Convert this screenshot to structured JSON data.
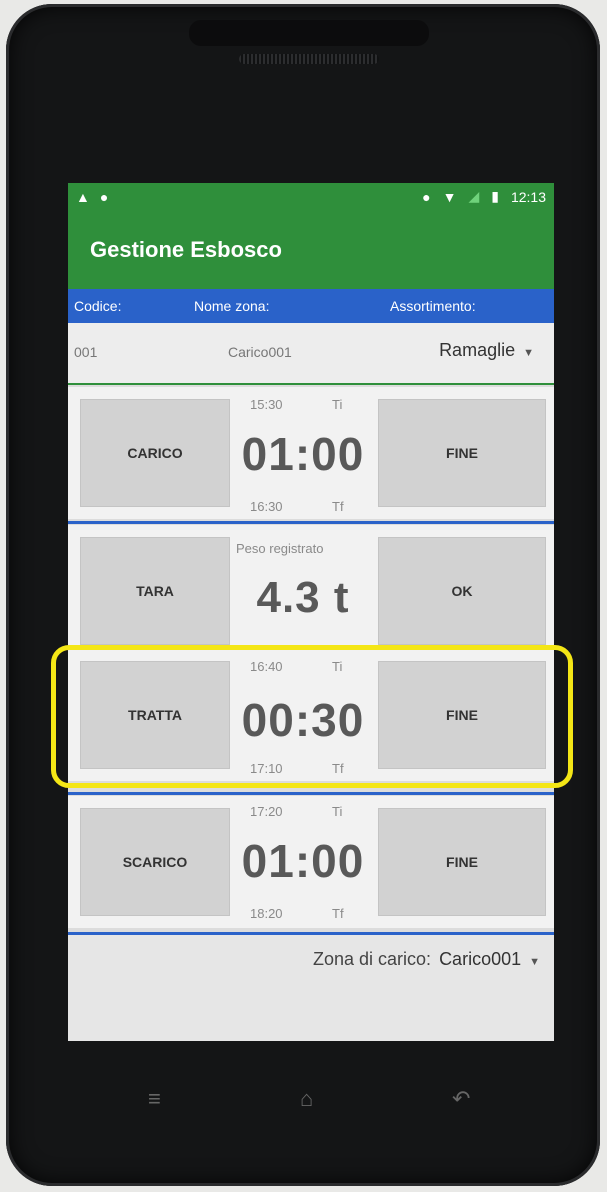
{
  "status_bar": {
    "time": "12:13",
    "left_icons": [
      "warning-icon",
      "dot-icon"
    ],
    "right_icons": [
      "location-icon",
      "wifi-icon",
      "signal-icon",
      "battery-icon"
    ]
  },
  "app": {
    "title": "Gestione Esbosco",
    "primary_color": "#2f8f3b",
    "accent_color": "#2a62c9"
  },
  "header": {
    "col_code": "Codice:",
    "col_zone": "Nome zona:",
    "col_assortment": "Assortimento:"
  },
  "info_row": {
    "code": "001",
    "zone_name": "Carico001",
    "assortment": "Ramaglie"
  },
  "sections": {
    "carico": {
      "label": "CARICO",
      "ti": "15:30",
      "ti_label": "Ti",
      "duration": "01:00",
      "tf": "16:30",
      "tf_label": "Tf",
      "end_label": "FINE"
    },
    "tara": {
      "label": "TARA",
      "caption": "Peso registrato",
      "weight": "4.3 t",
      "ok_label": "OK"
    },
    "tratta": {
      "label": "TRATTA",
      "ti": "16:40",
      "ti_label": "Ti",
      "duration": "00:30",
      "tf": "17:10",
      "tf_label": "Tf",
      "end_label": "FINE"
    },
    "scarico": {
      "label": "SCARICO",
      "ti": "17:20",
      "ti_label": "Ti",
      "duration": "01:00",
      "tf": "18:20",
      "tf_label": "Tf",
      "end_label": "FINE"
    }
  },
  "footer": {
    "zone_label": "Zona di carico:",
    "zone_value": "Carico001"
  },
  "nav": [
    "menu-icon",
    "home-icon",
    "back-icon"
  ]
}
